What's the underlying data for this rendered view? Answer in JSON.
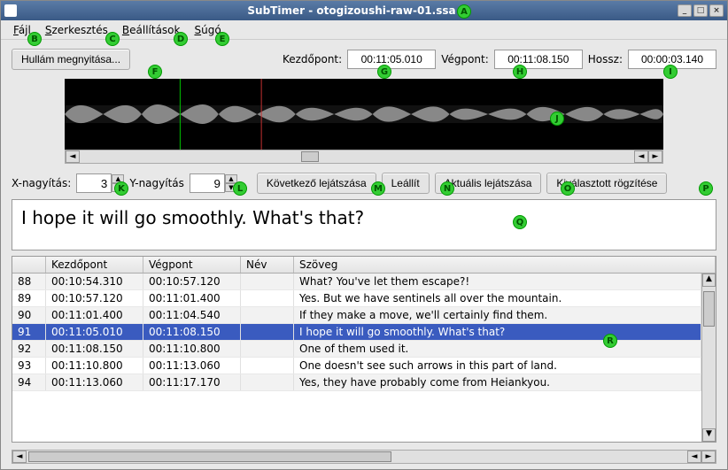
{
  "title": "SubTimer - otogizoushi-raw-01.ssa",
  "menu": {
    "file": "Fájl",
    "edit": "Szerkesztés",
    "settings": "Beállítások",
    "help": "Súgó"
  },
  "buttons": {
    "open_wave": "Hullám megnyitása...",
    "play_next": "Következő lejátszása",
    "stop": "Leállít",
    "play_current": "Aktuális lejátszása",
    "fix_selected": "Kiválasztott rögzítése"
  },
  "labels": {
    "start": "Kezdőpont:",
    "end": "Végpont:",
    "length": "Hossz:",
    "xzoom": "X-nagyítás:",
    "yzoom": "Y-nagyítás"
  },
  "fields": {
    "start": "00:11:05.010",
    "end": "00:11:08.150",
    "length": "00:00:03.140",
    "xzoom": "3",
    "yzoom": "9"
  },
  "edit_text": "I hope it will go smoothly. What's that?",
  "columns": {
    "idx": "",
    "start": "Kezdőpont",
    "end": "Végpont",
    "name": "Név",
    "text": "Szöveg"
  },
  "rows": [
    {
      "idx": "88",
      "start": "00:10:54.310",
      "end": "00:10:57.120",
      "name": "",
      "text": "What? You've let them escape?!",
      "sel": false
    },
    {
      "idx": "89",
      "start": "00:10:57.120",
      "end": "00:11:01.400",
      "name": "",
      "text": "Yes. But we have sentinels all over the mountain.",
      "sel": false
    },
    {
      "idx": "90",
      "start": "00:11:01.400",
      "end": "00:11:04.540",
      "name": "",
      "text": "If they make a move, we'll certainly find them.",
      "sel": false
    },
    {
      "idx": "91",
      "start": "00:11:05.010",
      "end": "00:11:08.150",
      "name": "",
      "text": "I hope it will go smoothly. What's that?",
      "sel": true
    },
    {
      "idx": "92",
      "start": "00:11:08.150",
      "end": "00:11:10.800",
      "name": "",
      "text": "One of them used it.",
      "sel": false
    },
    {
      "idx": "93",
      "start": "00:11:10.800",
      "end": "00:11:13.060",
      "name": "",
      "text": "One doesn't see such arrows in this part of land.",
      "sel": false
    },
    {
      "idx": "94",
      "start": "00:11:13.060",
      "end": "00:11:17.170",
      "name": "",
      "text": "Yes, they have probably come from Heiankyou.",
      "sel": false
    }
  ],
  "markers": [
    "A",
    "B",
    "C",
    "D",
    "E",
    "F",
    "G",
    "H",
    "I",
    "J",
    "K",
    "L",
    "M",
    "N",
    "O",
    "P",
    "Q",
    "R"
  ]
}
